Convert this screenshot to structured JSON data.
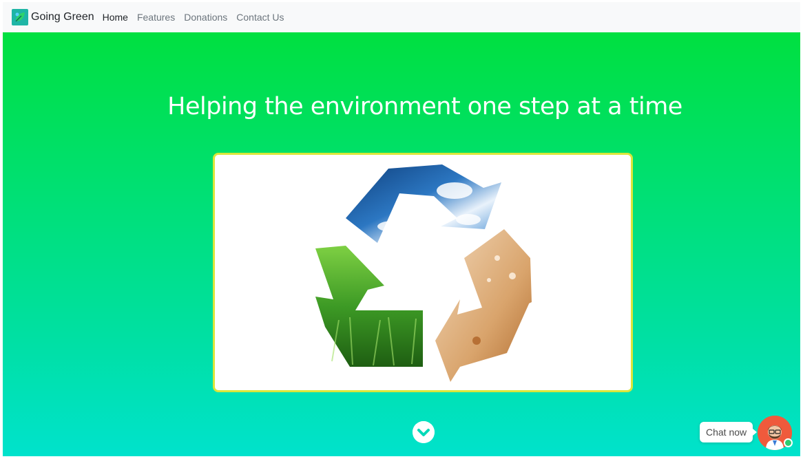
{
  "navbar": {
    "brand": {
      "name": "Going Green",
      "logo_icon": "leaf-logo-icon"
    },
    "links": [
      {
        "label": "Home",
        "active": true
      },
      {
        "label": "Features",
        "active": false
      },
      {
        "label": "Donations",
        "active": false
      },
      {
        "label": "Contact Us",
        "active": false
      }
    ]
  },
  "hero": {
    "title": "Helping the environment one step at a time",
    "image": "recycle-symbol-sky-water-grass",
    "scroll_icon": "chevron-down-icon"
  },
  "chat": {
    "label": "Chat now",
    "avatar_icon": "bearded-agent-avatar-icon",
    "status_color": "#2ecc71"
  },
  "colors": {
    "hero_top": "#00e040",
    "hero_bottom": "#00e2cc",
    "frame_border": "#dbe63a",
    "navbar_bg": "#f8f9fa"
  }
}
